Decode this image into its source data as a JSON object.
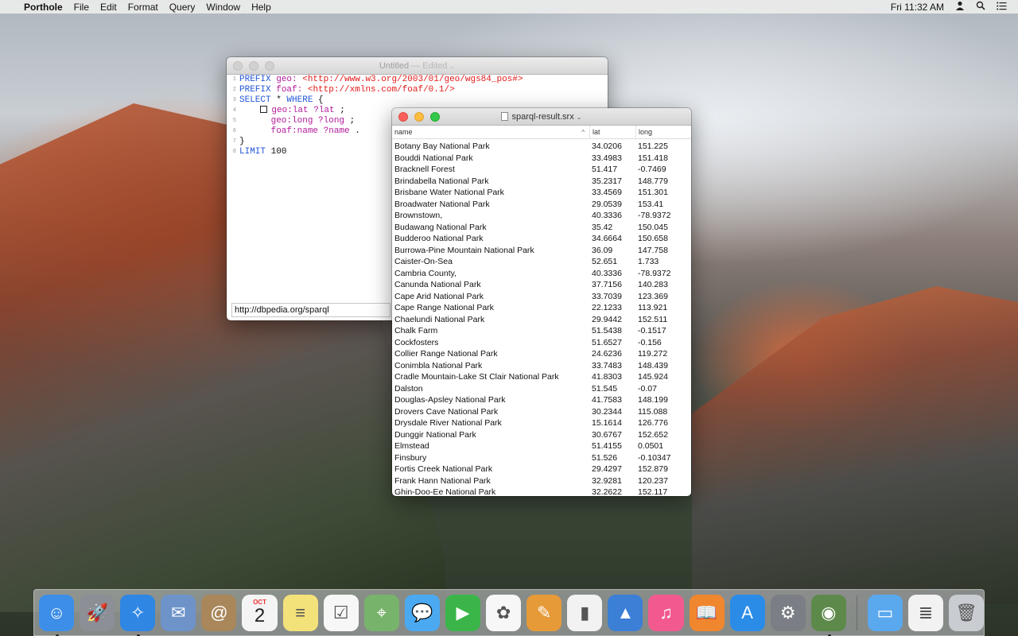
{
  "menubar": {
    "app": "Porthole",
    "items": [
      "File",
      "Edit",
      "Format",
      "Query",
      "Window",
      "Help"
    ],
    "clock": "Fri 11:32 AM"
  },
  "editor": {
    "title": "Untitled",
    "title_suffix": "— Edited",
    "lines": {
      "l1": {
        "kw": "PREFIX",
        "pn": "geo:",
        "uri": "<http://www.w3.org/2003/01/geo/wgs84_pos#>"
      },
      "l2": {
        "kw": "PREFIX",
        "pn": "foaf:",
        "uri": "<http://xmlns.com/foaf/0.1/>"
      },
      "l3": {
        "kw1": "SELECT",
        "mid": " * ",
        "kw2": "WHERE",
        "tail": " {"
      },
      "l4": {
        "pred": "geo:lat",
        "var": "?lat",
        "tail": " ;"
      },
      "l5": {
        "pred": "geo:long",
        "var": "?long",
        "tail": " ;"
      },
      "l6": {
        "pred": "foaf:name",
        "var": "?name",
        "tail": " ."
      },
      "l7": {
        "text": "}"
      },
      "l8": {
        "kw": "LIMIT",
        "num": " 100"
      }
    },
    "endpoint": "http://dbpedia.org/sparql"
  },
  "results": {
    "title": "sparql-result.srx",
    "columns": {
      "name": "name",
      "lat": "lat",
      "long": "long"
    },
    "rows": [
      [
        "Botany Bay National Park",
        "34.0206",
        "151.225"
      ],
      [
        "Bouddi National Park",
        "33.4983",
        "151.418"
      ],
      [
        "Bracknell Forest",
        "51.417",
        "-0.7469"
      ],
      [
        "Brindabella National Park",
        "35.2317",
        "148.779"
      ],
      [
        "Brisbane Water National Park",
        "33.4569",
        "151.301"
      ],
      [
        "Broadwater National Park",
        "29.0539",
        "153.41"
      ],
      [
        "Brownstown,",
        "40.3336",
        "-78.9372"
      ],
      [
        "Budawang National Park",
        "35.42",
        "150.045"
      ],
      [
        "Budderoo National Park",
        "34.6664",
        "150.658"
      ],
      [
        "Burrowa-Pine Mountain National Park",
        "36.09",
        "147.758"
      ],
      [
        "Caister-On-Sea",
        "52.651",
        "1.733"
      ],
      [
        "Cambria County,",
        "40.3336",
        "-78.9372"
      ],
      [
        "Canunda National Park",
        "37.7156",
        "140.283"
      ],
      [
        "Cape Arid National Park",
        "33.7039",
        "123.369"
      ],
      [
        "Cape Range National Park",
        "22.1233",
        "113.921"
      ],
      [
        "Chaelundi National Park",
        "29.9442",
        "152.511"
      ],
      [
        "Chalk Farm",
        "51.5438",
        "-0.1517"
      ],
      [
        "Cockfosters",
        "51.6527",
        "-0.156"
      ],
      [
        "Collier Range National Park",
        "24.6236",
        "119.272"
      ],
      [
        "Conimbla National Park",
        "33.7483",
        "148.439"
      ],
      [
        "Cradle Mountain-Lake St Clair National Park",
        "41.8303",
        "145.924"
      ],
      [
        "Dalston",
        "51.545",
        "-0.07"
      ],
      [
        "Douglas-Apsley National Park",
        "41.7583",
        "148.199"
      ],
      [
        "Drovers Cave National Park",
        "30.2344",
        "115.088"
      ],
      [
        "Drysdale River National Park",
        "15.1614",
        "126.776"
      ],
      [
        "Dunggir National Park",
        "30.6767",
        "152.652"
      ],
      [
        "Elmstead",
        "51.4155",
        "0.0501"
      ],
      [
        "Finsbury",
        "51.526",
        "-0.10347"
      ],
      [
        "Fortis Creek National Park",
        "29.4297",
        "152.879"
      ],
      [
        "Frank Hann National Park",
        "32.9281",
        "120.237"
      ],
      [
        "Ghin-Doo-Ee National Park",
        "32.2622",
        "152.117"
      ]
    ]
  },
  "dock": {
    "calendar_month": "OCT",
    "calendar_day": "2",
    "items": [
      {
        "name": "finder",
        "color": "#3d8ee8",
        "glyph": "☺",
        "running": true
      },
      {
        "name": "launchpad",
        "color": "#8d8f96",
        "glyph": "🚀",
        "running": false
      },
      {
        "name": "safari",
        "color": "#2f86e3",
        "glyph": "✧",
        "running": true
      },
      {
        "name": "mail",
        "color": "#6d93c9",
        "glyph": "✉",
        "running": false
      },
      {
        "name": "contacts",
        "color": "#a9875a",
        "glyph": "@",
        "running": false
      },
      {
        "name": "calendar",
        "color": "#f4f4f4",
        "glyph": "",
        "running": false
      },
      {
        "name": "notes",
        "color": "#f3e17a",
        "glyph": "≡",
        "running": false
      },
      {
        "name": "reminders",
        "color": "#f7f7f7",
        "glyph": "☑",
        "running": false
      },
      {
        "name": "maps",
        "color": "#77b36b",
        "glyph": "⌖",
        "running": false
      },
      {
        "name": "messages",
        "color": "#4ba9f2",
        "glyph": "💬",
        "running": false
      },
      {
        "name": "facetime",
        "color": "#3bb54a",
        "glyph": "▶",
        "running": false
      },
      {
        "name": "photos",
        "color": "#f7f7f7",
        "glyph": "✿",
        "running": false
      },
      {
        "name": "pages",
        "color": "#e69a38",
        "glyph": "✎",
        "running": false
      },
      {
        "name": "numbers",
        "color": "#f2f2f2",
        "glyph": "▮",
        "running": false
      },
      {
        "name": "keynote",
        "color": "#3b7fd6",
        "glyph": "▲",
        "running": false
      },
      {
        "name": "itunes",
        "color": "#f25a8f",
        "glyph": "♫",
        "running": false
      },
      {
        "name": "ibooks",
        "color": "#f0862e",
        "glyph": "📖",
        "running": false
      },
      {
        "name": "app-store",
        "color": "#2b8ce8",
        "glyph": "A",
        "running": false
      },
      {
        "name": "system-preferences",
        "color": "#7b7e84",
        "glyph": "⚙",
        "running": false
      },
      {
        "name": "porthole",
        "color": "#5d8a4a",
        "glyph": "◉",
        "running": true
      }
    ],
    "right_items": [
      {
        "name": "folder",
        "color": "#5aa8ee",
        "glyph": "▭"
      },
      {
        "name": "document",
        "color": "#f2f2f2",
        "glyph": "≣"
      },
      {
        "name": "trash",
        "color": "#c9ccd0",
        "glyph": "🗑"
      }
    ]
  }
}
